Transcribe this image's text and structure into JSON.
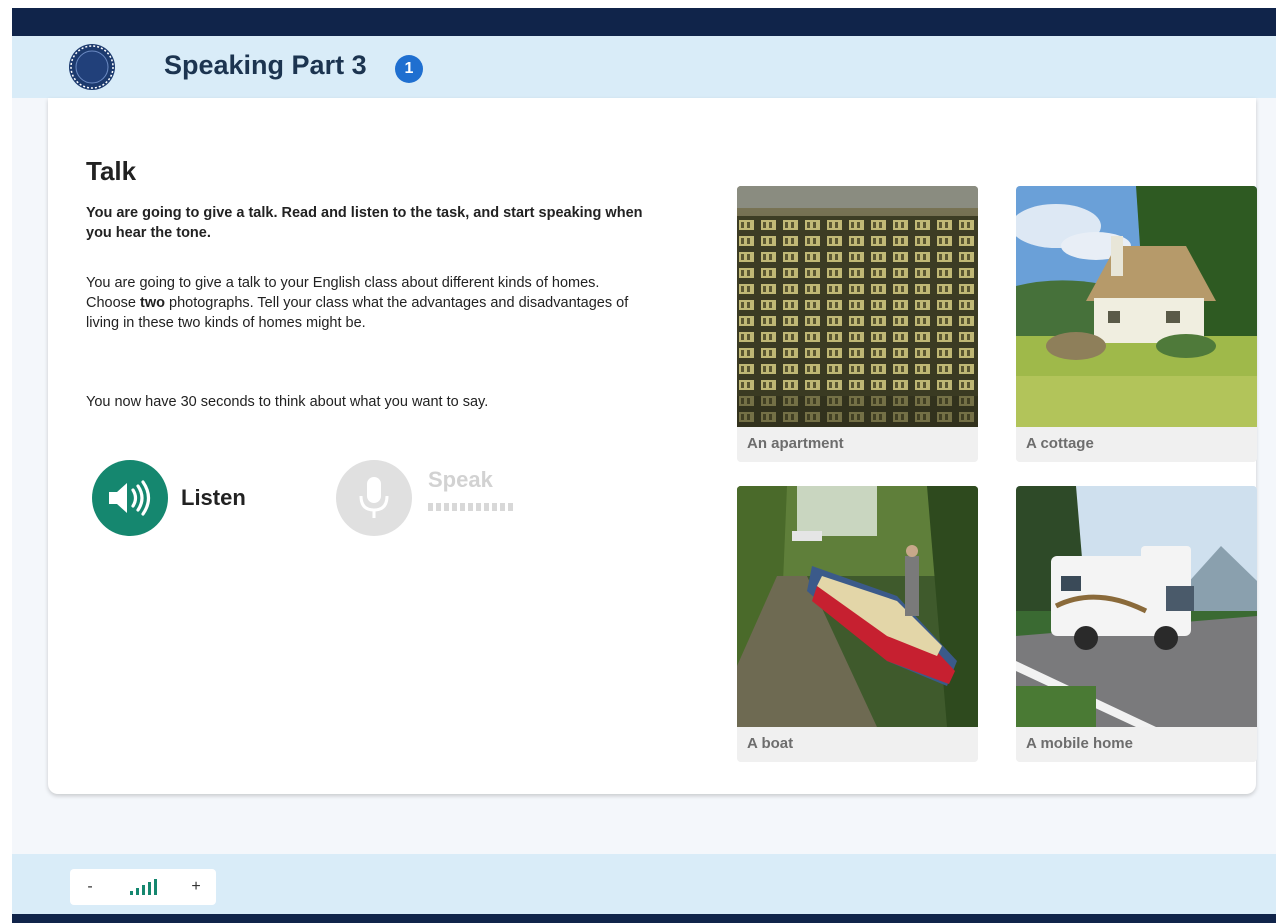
{
  "header": {
    "title": "Speaking Part 3",
    "badge": "1",
    "logo_icon": "seal-logo-icon"
  },
  "task": {
    "title": "Talk",
    "instruction": "You are going to give a talk. Read and listen to the task, and start speaking when you hear the tone.",
    "text_before_bold": "You are going to give a talk to your English class about different kinds of homes. Choose ",
    "text_bold": "two",
    "text_after_bold": " photographs. Tell your class what the advantages and disadvantages of living in these two kinds of homes might be.",
    "think": "You now have 30 seconds to think about what you want to say."
  },
  "controls": {
    "listen_label": "Listen",
    "listen_icon": "speaker-icon",
    "speak_label": "Speak",
    "speak_icon": "microphone-icon",
    "speak_enabled": false
  },
  "photos": [
    {
      "caption": "An apartment"
    },
    {
      "caption": "A cottage"
    },
    {
      "caption": "A boat"
    },
    {
      "caption": "A mobile home"
    }
  ],
  "footer": {
    "volume_down": "-",
    "volume_up": "+",
    "volume_icon": "volume-bars-icon"
  },
  "colors": {
    "accent": "#15876f",
    "navy": "#10244a",
    "header_bg": "#d9ecf8",
    "badge": "#1f6fd0"
  }
}
